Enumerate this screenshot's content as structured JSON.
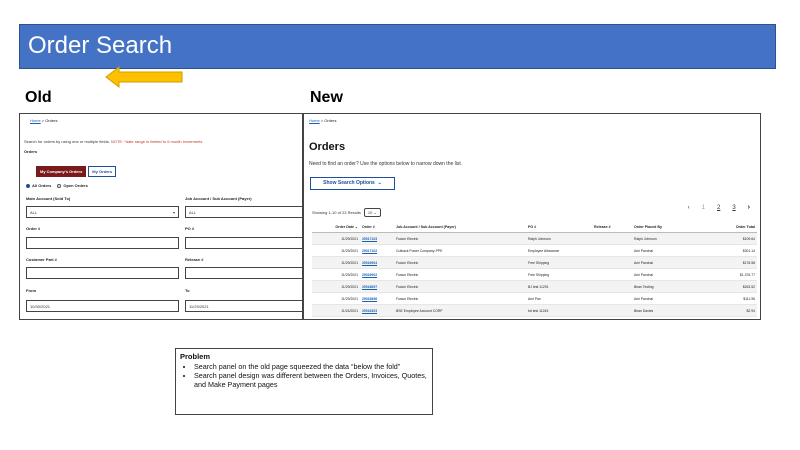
{
  "title": "Order Search",
  "labels": {
    "old": "Old",
    "new": "New"
  },
  "old": {
    "breadcrumb_home": "Home",
    "breadcrumb_rest": " > Orders",
    "hint": "Search for orders by using one or multiple fields.",
    "note": "NOTE: *date range is limited to 6 month increments",
    "subtitle": "Orders",
    "toggle_mine": "My Company's Orders",
    "toggle_my": "My Orders",
    "radio_all": "All Orders",
    "radio_open": "Open Orders",
    "main_account_label": "Main Account (Sold To)",
    "main_account_value": "ALL",
    "job_account_label": "Job Account / Sub Account (Payer)",
    "job_account_value": "ALL",
    "order_label": "Order #",
    "po_label": "PO #",
    "customer_part_label": "Customer Part #",
    "release_label": "Release #",
    "from_label": "From",
    "from_value": "10/30/2021",
    "to_label": "To",
    "to_value": "11/29/2021"
  },
  "new": {
    "breadcrumb_home": "Home",
    "breadcrumb_rest": " > Orders",
    "heading": "Orders",
    "lead": "Need to find an order? Use the options below to narrow down the list.",
    "search_button": "Show Search Options",
    "showing": "Showing 1-10 of 23 Results",
    "page_size": "10",
    "pages": [
      "1",
      "2",
      "3"
    ],
    "columns": [
      "Order Date",
      "Order #",
      "Job Account / Sub Account (Payer)",
      "PO #",
      "Release #",
      "Order Placed By",
      "Order Total"
    ],
    "rows": [
      [
        "11/29/2021",
        "25017103",
        "Fusion Electric",
        "Ralph Johnson",
        "",
        "Ralph Johnson",
        "$109.64"
      ],
      [
        "11/29/2021",
        "25017102",
        "Cutback Power Company-PPE",
        "Employee Allowance",
        "",
        "Ami Panchal",
        "$301.14"
      ],
      [
        "11/29/2021",
        "25016904",
        "Fusion Electric",
        "Free Shipping",
        "",
        "Ami Panchal",
        "$176.58"
      ],
      [
        "11/29/2021",
        "25016902",
        "Fusion Electric",
        "Free Shipping",
        "",
        "Ami Panchal",
        "$1,376.77"
      ],
      [
        "11/29/2021",
        "25016897",
        "Fusion Electric",
        "BJ test 11291",
        "",
        "Brian Testing",
        "$263.52"
      ],
      [
        "11/29/2021",
        "25016896",
        "Fusion Electric",
        "Ami Pan",
        "",
        "Ami Panchal",
        "$111.96"
      ],
      [
        "11/24/2021",
        "25016303",
        "BSE Employee Account CORP",
        "bd test 11243",
        "",
        "Brian Davies",
        "$2.94"
      ]
    ]
  },
  "problem": {
    "title": "Problem",
    "bullets": [
      "Search panel on the old page squeezed the data “below the fold”",
      "Search panel design was different between the Orders, Invoices, Quotes, and Make Payment pages"
    ]
  },
  "colors": {
    "banner": "#4472c4",
    "arrow": "#ffc000",
    "maroon": "#7b1a1a",
    "link": "#1a5fb4"
  }
}
